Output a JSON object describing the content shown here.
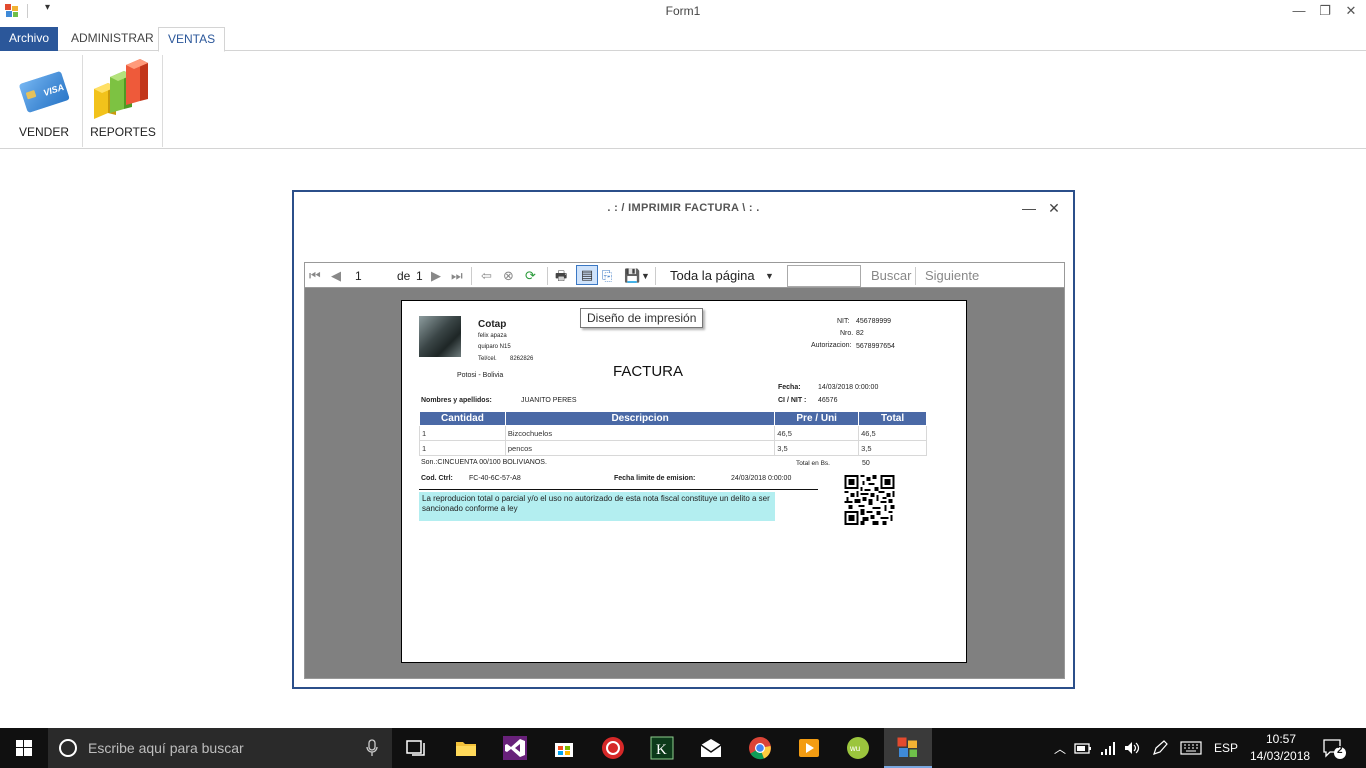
{
  "window": {
    "title": "Form1",
    "minimize": "—",
    "restore": "❐",
    "close": "✕",
    "qa_arrow": "▾"
  },
  "ribbon": {
    "tabs": [
      {
        "label": "Archivo"
      },
      {
        "label": "ADMINISTRAR"
      },
      {
        "label": "VENTAS"
      }
    ],
    "buttons": [
      {
        "label": "VENDER",
        "icon": "credit-card-icon"
      },
      {
        "label": "REPORTES",
        "icon": "bar-chart-icon"
      }
    ]
  },
  "dialog": {
    "title": ". : / IMPRIMIR FACTURA \\ : .",
    "minimize": "—",
    "close": "✕"
  },
  "viewer_toolbar": {
    "page_current": "1",
    "page_of": "de",
    "page_total": "1",
    "zoom": "Toda la página",
    "search_value": "",
    "search_label": "Buscar",
    "next_label": "Siguiente",
    "tooltip": "Diseño de impresión"
  },
  "invoice": {
    "company": "Cotap",
    "address1": "felix apaza",
    "address2": "quiparo N15",
    "phone_label": "Tel/cel.",
    "phone": "8262826",
    "location": "Potosi - Bolivia",
    "nit_label": "NIT:",
    "nit": "456789999",
    "nro_label": "Nro.",
    "nro": "82",
    "auth_label": "Autorizacion:",
    "auth": "5678997654",
    "title": "FACTURA",
    "fecha_label": "Fecha:",
    "fecha": "14/03/2018 0:00:00",
    "client_label": "Nombres y apellidos:",
    "client": "JUANITO PERES",
    "ci_label": "CI / NIT :",
    "ci": "46576",
    "columns": [
      "Cantidad",
      "Descripcion",
      "Pre / Uni",
      "Total"
    ],
    "rows": [
      [
        "1",
        "Bizcochuelos",
        "46,5",
        "46,5"
      ],
      [
        "1",
        "pencos",
        "3,5",
        "3,5"
      ]
    ],
    "son": "Son.:CINCUENTA 00/100 BOLIVIANOS.",
    "total_label": "Total en Bs.",
    "total": "50",
    "cod_label": "Cod. Ctrl:",
    "cod": "FC-40-6C-57-A8",
    "limit_label": "Fecha limite de emision:",
    "limit": "24/03/2018 0:00:00",
    "legal": "La reproducion total o parcial y/o el uso no autorizado de esta nota fiscal constituye un delito a ser sancionado conforme a ley"
  },
  "taskbar": {
    "search_placeholder": "Escribe aquí para buscar",
    "lang": "ESP",
    "time": "10:57",
    "date": "14/03/2018",
    "notifications": "2"
  }
}
